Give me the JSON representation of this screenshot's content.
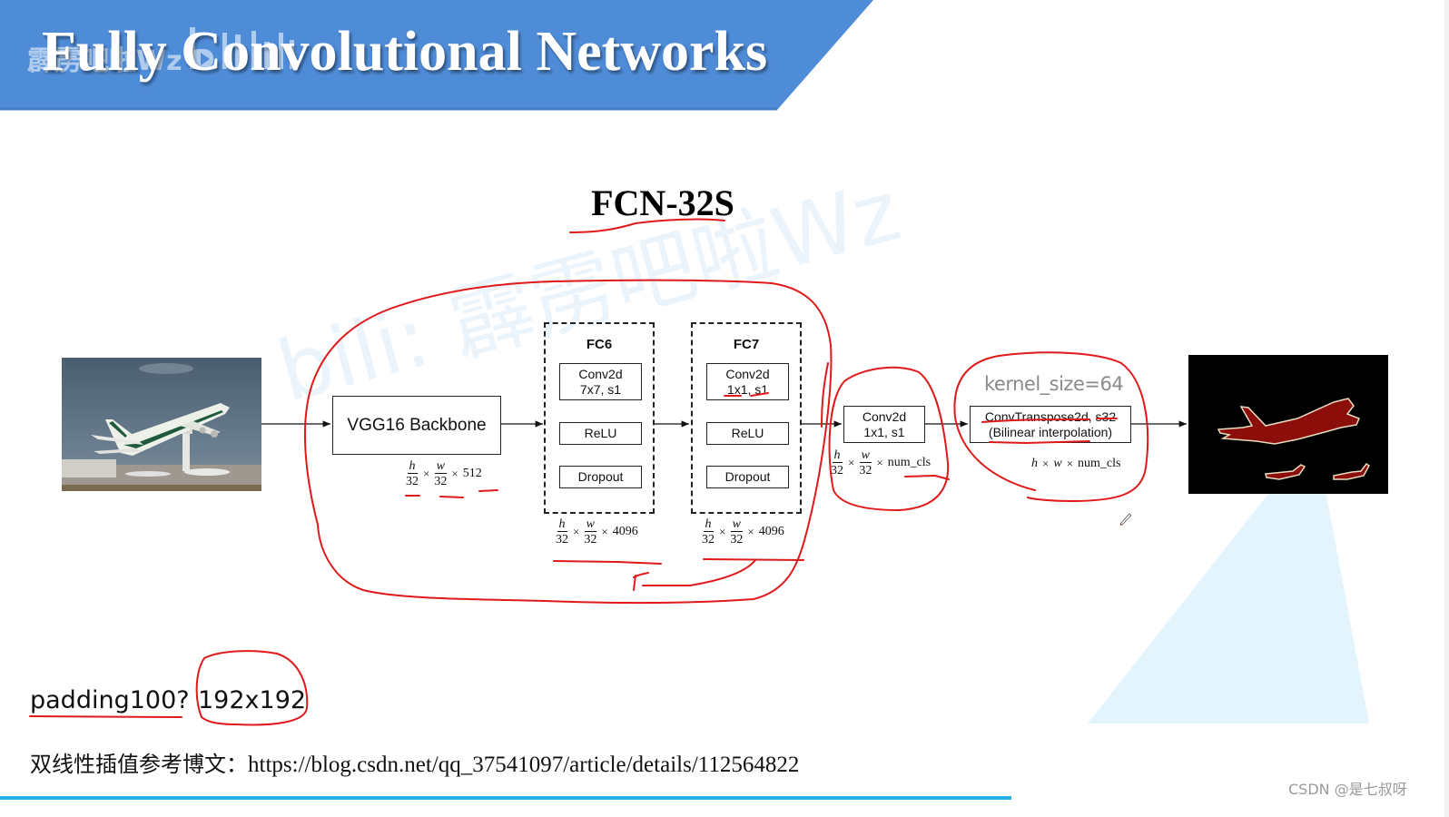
{
  "header": {
    "title": "Fully Convolutional Networks",
    "watermark": "霹雳吧啦Wz",
    "banner_color": "#4f8cd8"
  },
  "diagram": {
    "title": "FCN-32S",
    "center_watermark": "bili: 霹雳吧啦Wz",
    "input_image": "airplane-photo",
    "output_image": "segmentation-mask",
    "vgg_box": {
      "label": "VGG16 Backbone"
    },
    "vgg_dim": {
      "h": "h",
      "w": "w",
      "den": "32",
      "times": "×",
      "channels": "512"
    },
    "fc6": {
      "title": "FC6",
      "conv_line1": "Conv2d",
      "conv_line2": "7x7, s1",
      "relu": "ReLU",
      "dropout": "Dropout",
      "dim": {
        "h": "h",
        "w": "w",
        "den": "32",
        "times": "×",
        "channels": "4096"
      }
    },
    "fc7": {
      "title": "FC7",
      "conv_line1": "Conv2d",
      "conv_line2": "1x1, s1",
      "relu": "ReLU",
      "dropout": "Dropout",
      "dim": {
        "h": "h",
        "w": "w",
        "den": "32",
        "times": "×",
        "channels": "4096"
      }
    },
    "conv1x1": {
      "line1": "Conv2d",
      "line2": "1x1, s1",
      "dim": {
        "h": "h",
        "w": "w",
        "den": "32",
        "times": "×",
        "channels": "num_cls"
      }
    },
    "convtranspose": {
      "line1": "ConvTranspose2d, s32",
      "line2": "(Bilinear interpolation)",
      "kernel_note": "kernel_size=64",
      "dim": {
        "h": "h",
        "w": "w",
        "times": "×",
        "channels": "num_cls"
      }
    },
    "annotation_color": "#e0191b"
  },
  "notes": {
    "padding": "padding100?",
    "size": "192x192",
    "ref_label": "双线性插值参考博文：",
    "ref_url": "https://blog.csdn.net/qq_37541097/article/details/112564822"
  },
  "footer": {
    "csdn_watermark": "CSDN @是七叔呀",
    "bar_color": "#27aee3"
  }
}
